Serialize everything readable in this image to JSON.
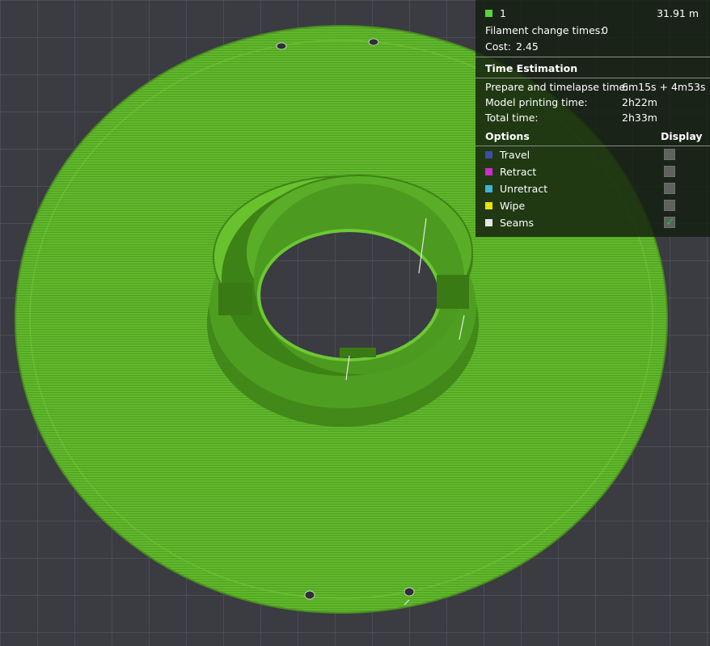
{
  "legend": {
    "filament": {
      "label": "1",
      "length": "31.91 m",
      "color": "#5bd23c"
    },
    "filament_change": {
      "label": "Filament change times:",
      "value": "0"
    },
    "cost": {
      "label": "Cost:",
      "value": "2.45"
    },
    "time_estimation": {
      "heading": "Time Estimation",
      "rows": [
        {
          "label": "Prepare and timelapse time:",
          "value": "6m15s + 4m53s"
        },
        {
          "label": "Model printing time:",
          "value": "2h22m"
        },
        {
          "label": "Total time:",
          "value": "2h33m"
        }
      ]
    },
    "options": {
      "heading": "Options",
      "display_heading": "Display",
      "items": [
        {
          "label": "Travel",
          "color": "#3a4ea8",
          "checked": false
        },
        {
          "label": "Retract",
          "color": "#d22ad2",
          "checked": false
        },
        {
          "label": "Unretract",
          "color": "#3fb4d2",
          "checked": false
        },
        {
          "label": "Wipe",
          "color": "#e8e20a",
          "checked": false
        },
        {
          "label": "Seams",
          "color": "#e6e6e6",
          "checked": true
        }
      ]
    }
  },
  "model": {
    "color": "#5fb82a"
  }
}
